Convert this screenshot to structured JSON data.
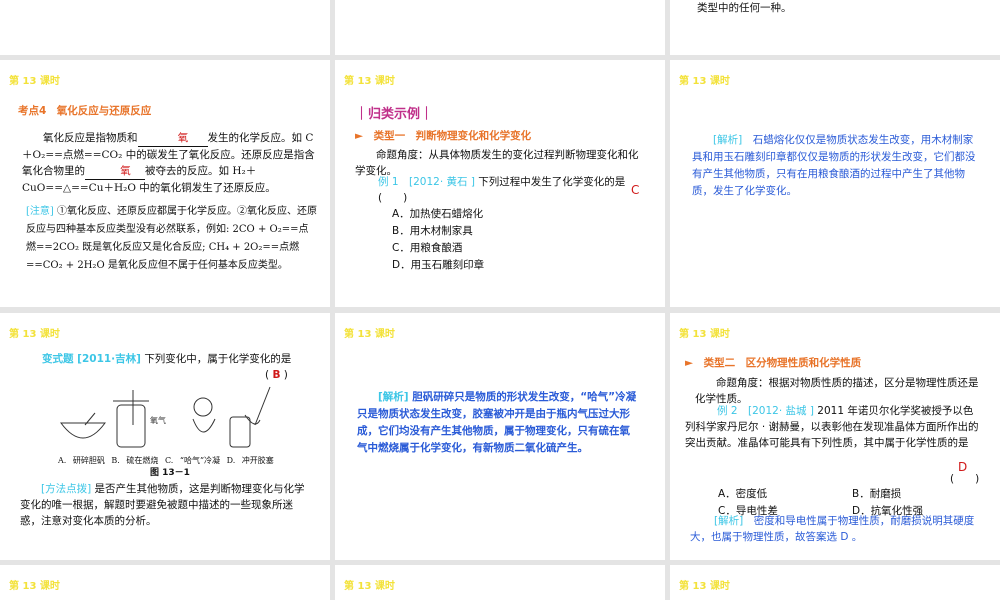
{
  "header": "第 13 课时",
  "slide_top_right_partial": "类型中的任何一种。",
  "s1": {
    "title": "考点4　氧化反应与还原反应",
    "p1a": "氧化反应是指物质和",
    "blank1": "氧",
    "p1b": "发生的化学反应。如 C＋O₂==点燃==CO₂ 中的碳发生了氧化反应。还原反应是指含氧化合物里的",
    "blank2": "氧",
    "p1c": "被夺去的反应。如 H₂＋CuO==△==Cu＋H₂O 中的氧化铜发生了还原反应。",
    "note_label": "[注意]",
    "note": "①氧化反应、还原反应都属于化学反应。②氧化反应、还原反应与四种基本反应类型没有必然联系，例如: 2CO + O₂==点燃==2CO₂ 既是氧化反应又是化合反应; CH₄ + 2O₂==点燃==CO₂ + 2H₂O 是氧化反应但不属于任何基本反应类型。"
  },
  "s2": {
    "section": "｜归类示例｜",
    "type": "►　类型一　判断物理变化和化学变化",
    "angle": "命题角度：从具体物质发生的变化过程判断物理变化和化学变化。",
    "ex_label": "例 1　[2012· 黄石 ]",
    "question": "下列过程中发生了化学变化的是 (　　)",
    "answer": "C",
    "options": [
      "A．加热使石蜡熔化",
      "B．用木材制家具",
      "C．用粮食酿酒",
      "D．用玉石雕刻印章"
    ]
  },
  "s3": {
    "label": "[解析]",
    "text": "石蜡熔化仅仅是物质状态发生改变，用木材制家具和用玉石雕刻印章都仅仅是物质的形状发生改变，它们都没有产生其他物质，只有在用粮食酿酒的过程中产生了其他物质，发生了化学变化。"
  },
  "s4": {
    "ex_label": "变式题 [2011·吉林]",
    "question": "下列变化中，属于化学变化的是",
    "answer": "B",
    "fig_caps": [
      "A. 研碎胆矾",
      "B. 硫在燃烧",
      "C. “哈气”冷凝",
      "D. 冲开胶塞"
    ],
    "oxygen": "氧气",
    "fig": "图 13－1",
    "tip_label": "[方法点拨]",
    "tip": "是否产生其他物质，这是判断物理变化与化学变化的唯一根据，解题时要避免被题中描述的一些现象所迷惑，注意对变化本质的分析。"
  },
  "s5": {
    "label": "[解析]",
    "text": "胆矾研碎只是物质的形状发生改变，“哈气”冷凝只是物质状态发生改变，胶塞被冲开是由于瓶内气压过大形成，它们均没有产生其他物质，属于物理变化，只有硫在氧气中燃烧属于化学变化，有新物质二氧化硫产生。"
  },
  "s6": {
    "type": "►　类型二　区分物理性质和化学性质",
    "angle": "命题角度：根据对物质性质的描述，区分是物理性质还是化学性质。",
    "ex_label": "例 2　[2012· 盐城 ]",
    "question": "2011 年诺贝尔化学奖被授予以色列科学家丹尼尔 · 谢赫曼，以表彰他在发现准晶体方面所作出的突出贡献。准晶体可能具有下列性质，其中属于化学性质的是",
    "paren": "(　　)",
    "answer": "D",
    "options": [
      "A．密度低",
      "B．耐磨损",
      "C．导电性差",
      "D．抗氧化性强"
    ],
    "ana_label": "[解析]",
    "ana": "密度和导电性属于物理性质，耐磨损说明其硬度大，也属于物理性质，故答案选 D 。"
  }
}
